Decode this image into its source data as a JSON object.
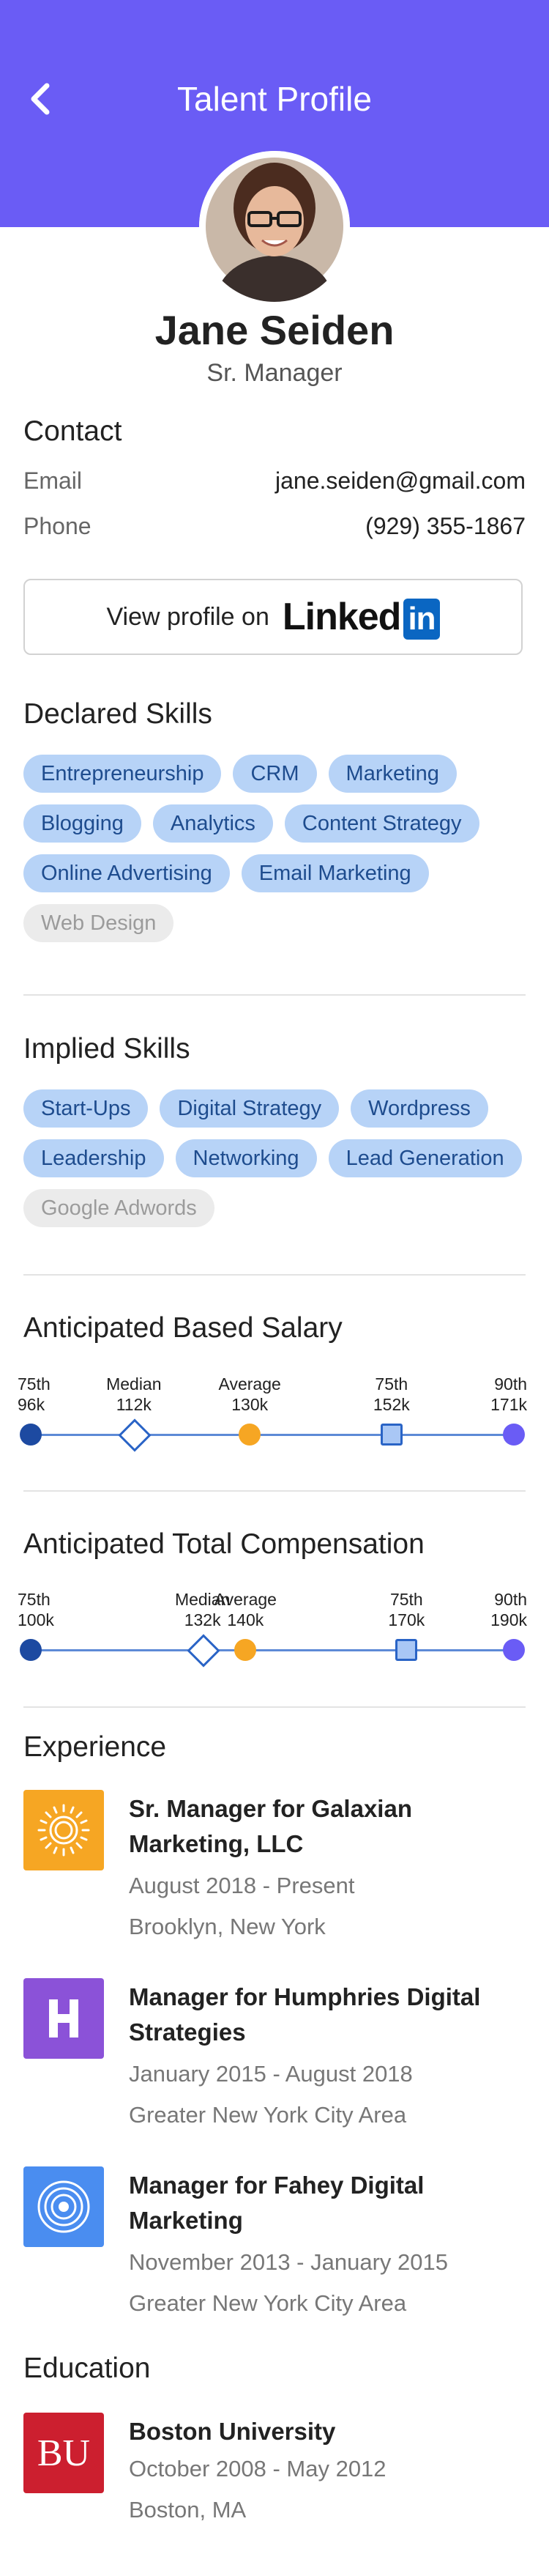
{
  "header": {
    "title": "Talent Profile",
    "back_icon": "chevron-left-icon",
    "bg": "#6a5cf5"
  },
  "profile": {
    "name": "Jane Seiden",
    "role": "Sr. Manager"
  },
  "contact": {
    "title": "Contact",
    "email_label": "Email",
    "email_value": "jane.seiden@gmail.com",
    "phone_label": "Phone",
    "phone_value": "(929) 355-1867"
  },
  "linkedin": {
    "prefix": "View profile on",
    "brand_word": "Linked",
    "brand_in": "in"
  },
  "declared_skills": {
    "title": "Declared Skills",
    "items": [
      {
        "label": "Entrepreneurship",
        "state": "active"
      },
      {
        "label": "CRM",
        "state": "active"
      },
      {
        "label": "Marketing",
        "state": "active"
      },
      {
        "label": "Blogging",
        "state": "active"
      },
      {
        "label": "Analytics",
        "state": "active"
      },
      {
        "label": "Content Strategy",
        "state": "active"
      },
      {
        "label": "Online Advertising",
        "state": "active"
      },
      {
        "label": "Email Marketing",
        "state": "active"
      },
      {
        "label": "Web Design",
        "state": "muted"
      }
    ]
  },
  "implied_skills": {
    "title": "Implied Skills",
    "items": [
      {
        "label": "Start-Ups",
        "state": "active"
      },
      {
        "label": "Digital Strategy",
        "state": "active"
      },
      {
        "label": "Wordpress",
        "state": "active"
      },
      {
        "label": "Leadership",
        "state": "active"
      },
      {
        "label": "Networking",
        "state": "active"
      },
      {
        "label": "Lead Generation",
        "state": "active"
      },
      {
        "label": "Google Adwords",
        "state": "muted"
      }
    ]
  },
  "base_salary": {
    "title": "Anticipated Based Salary",
    "points": [
      {
        "label": "75th",
        "value": "96k",
        "marker": "dot-blue"
      },
      {
        "label": "Median",
        "value": "112k",
        "marker": "diamond"
      },
      {
        "label": "Average",
        "value": "130k",
        "marker": "dot-yellow"
      },
      {
        "label": "75th",
        "value": "152k",
        "marker": "square"
      },
      {
        "label": "90th",
        "value": "171k",
        "marker": "dot-purple"
      }
    ]
  },
  "total_comp": {
    "title": "Anticipated Total Compensation",
    "points": [
      {
        "label": "75th",
        "value": "100k",
        "marker": "dot-blue"
      },
      {
        "label": "Median",
        "value": "132k",
        "marker": "diamond"
      },
      {
        "label": "Average",
        "value": "140k",
        "marker": "dot-yellow"
      },
      {
        "label": "75th",
        "value": "170k",
        "marker": "square"
      },
      {
        "label": "90th",
        "value": "190k",
        "marker": "dot-purple"
      }
    ]
  },
  "experience": {
    "title": "Experience",
    "items": [
      {
        "title": "Sr. Manager for Galaxian Marketing, LLC",
        "dates": "August 2018 - Present",
        "location": "Brooklyn, New York",
        "logo": "sun-logo-icon",
        "color": "#f6a623"
      },
      {
        "title": "Manager for Humphries Digital Strategies",
        "dates": "January 2015 - August 2018",
        "location": "Greater New York City Area",
        "logo": "h-letter-logo-icon",
        "color": "#8b52d8"
      },
      {
        "title": "Manager for Fahey Digital Marketing",
        "dates": "November 2013 - January 2015",
        "location": "Greater New York City Area",
        "logo": "concentric-circles-logo-icon",
        "color": "#4a8df0"
      }
    ]
  },
  "education": {
    "title": "Education",
    "items": [
      {
        "school": "Boston University",
        "dates": "October 2008 - May 2012",
        "location": "Boston, MA",
        "logo_text": "BU",
        "color": "#cc1f2f"
      }
    ]
  }
}
